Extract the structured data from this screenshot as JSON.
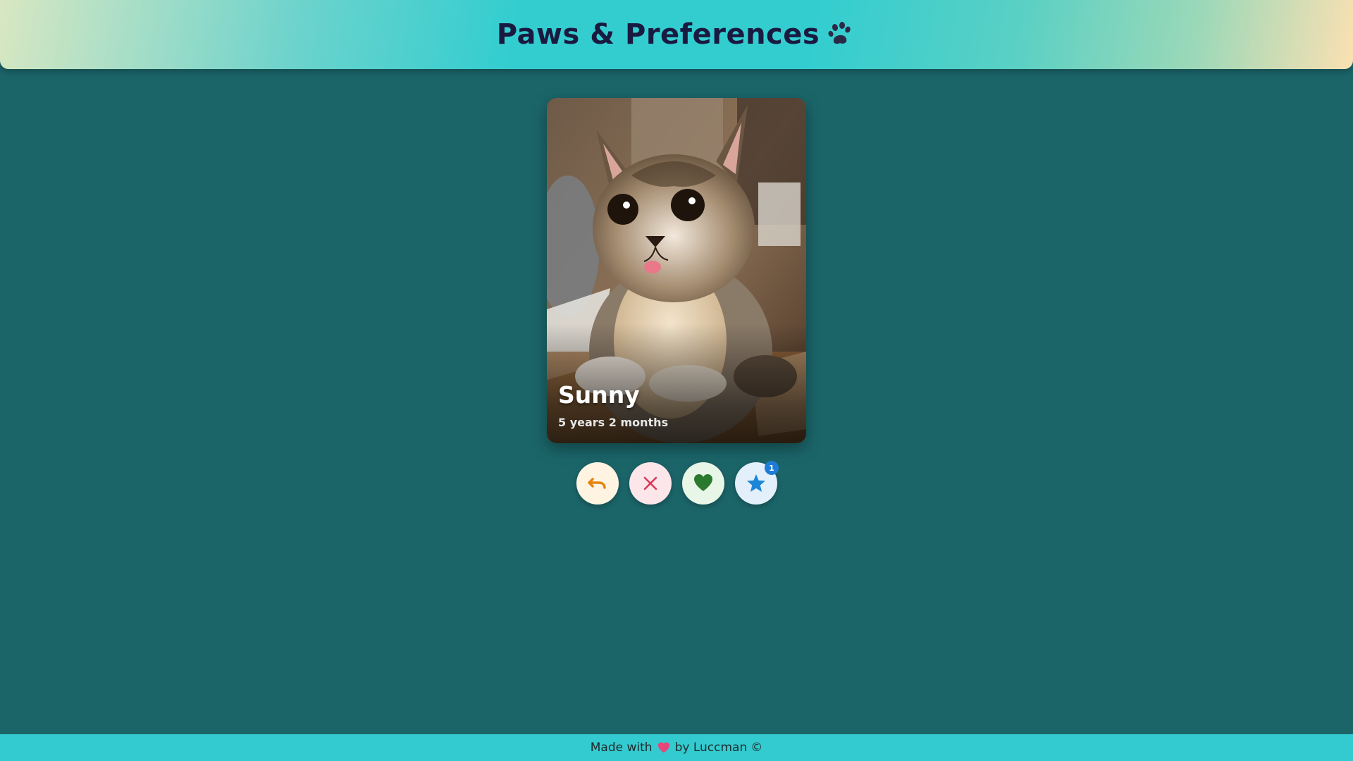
{
  "header": {
    "title": "Paws & Preferences",
    "icon": "paw-icon"
  },
  "card": {
    "name": "Sunny",
    "age": "5 years 2 months",
    "photo": "tabby-kitten-photo"
  },
  "actions": [
    {
      "name": "undo-button",
      "icon": "undo-icon",
      "color": "#e8830c"
    },
    {
      "name": "dislike-button",
      "icon": "close-icon",
      "color": "#d93a54"
    },
    {
      "name": "like-button",
      "icon": "heart-icon",
      "color": "#2a7a2e"
    },
    {
      "name": "favorite-button",
      "icon": "star-icon",
      "color": "#1e86d6",
      "badge": "1"
    }
  ],
  "footer": {
    "prefix": "Made with",
    "suffix": "by Luccman",
    "copyright": "©",
    "heart_color": "#e8457a"
  },
  "colors": {
    "background": "#1b6569",
    "header_accent": "#33cdd0",
    "footer": "#33cbcf"
  }
}
